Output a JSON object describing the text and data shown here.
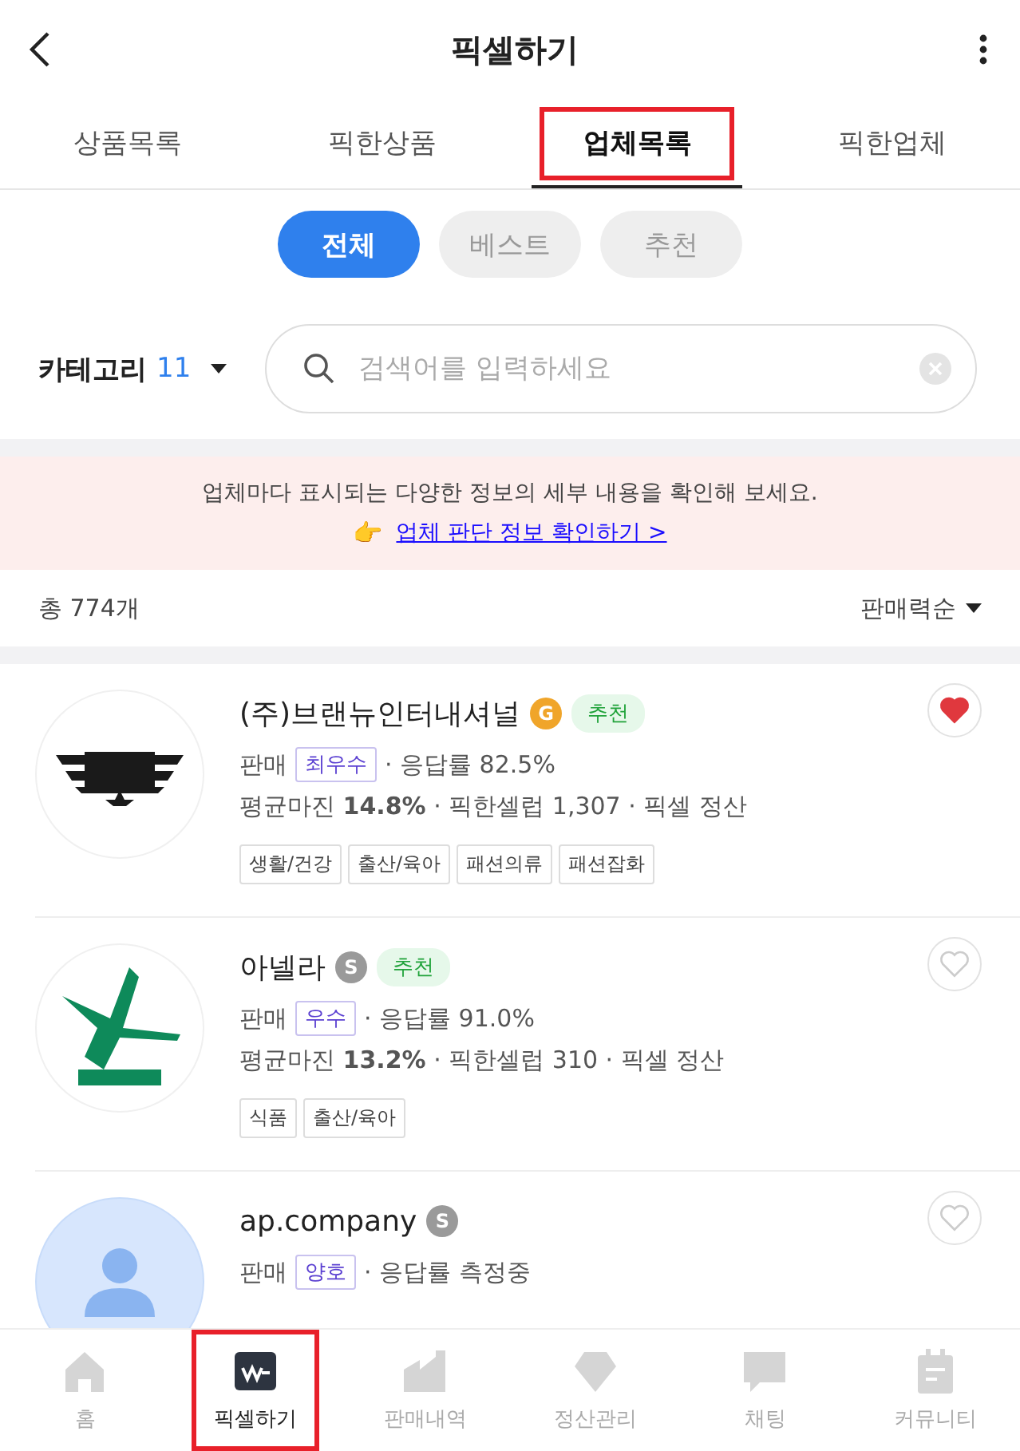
{
  "header": {
    "title": "픽셀하기"
  },
  "tabs": [
    {
      "label": "상품목록",
      "selected": false,
      "highlighted": false
    },
    {
      "label": "픽한상품",
      "selected": false,
      "highlighted": false
    },
    {
      "label": "업체목록",
      "selected": true,
      "highlighted": true
    },
    {
      "label": "픽한업체",
      "selected": false,
      "highlighted": false
    }
  ],
  "filters": [
    {
      "label": "전체",
      "selected": true
    },
    {
      "label": "베스트",
      "selected": false
    },
    {
      "label": "추천",
      "selected": false
    }
  ],
  "category": {
    "label": "카테고리",
    "count": "11"
  },
  "search": {
    "placeholder": "검색어를 입력하세요"
  },
  "notice": {
    "text": "업체마다 표시되는 다양한 정보의 세부 내용을 확인해 보세요.",
    "emoji": "👉",
    "link": "업체 판단 정보 확인하기 >"
  },
  "summary": {
    "total": "총 774개",
    "sort": "판매력순"
  },
  "vendors": [
    {
      "logo": {
        "kind": "wings"
      },
      "name": "(주)브랜뉴인터내셔널",
      "grade": {
        "label": "G",
        "kind": "gold"
      },
      "recommended": "추천",
      "liked": true,
      "sales_label": "판매",
      "sales_grade": "최우수",
      "response": "· 응답률 82.5%",
      "stats": "평균마진 **14.8%** · 픽한셀럽 1,307 · 픽셀 정산",
      "tags": [
        "생활/건강",
        "출산/육아",
        "패션의류",
        "패션잡화"
      ]
    },
    {
      "logo": {
        "kind": "bird"
      },
      "name": "아넬라",
      "grade": {
        "label": "S",
        "kind": "silver"
      },
      "recommended": "추천",
      "liked": false,
      "sales_label": "판매",
      "sales_grade": "우수",
      "response": "· 응답률 91.0%",
      "stats": "평균마진 **13.2%** · 픽한셀럽 310 · 픽셀 정산",
      "tags": [
        "식품",
        "출산/육아"
      ]
    },
    {
      "logo": {
        "kind": "avatar"
      },
      "name": "ap.company",
      "grade": {
        "label": "S",
        "kind": "silver"
      },
      "liked": false,
      "sales_label": "판매",
      "sales_grade": "양호",
      "response": "· 응답률 측정중"
    }
  ],
  "nav": [
    {
      "kind": "home",
      "label": "홈",
      "selected": false,
      "highlighted": false
    },
    {
      "kind": "pick",
      "label": "픽셀하기",
      "selected": true,
      "highlighted": true
    },
    {
      "kind": "factory",
      "label": "판매내역",
      "selected": false,
      "highlighted": false
    },
    {
      "kind": "gem",
      "label": "정산관리",
      "selected": false,
      "highlighted": false
    },
    {
      "kind": "chat",
      "label": "채팅",
      "selected": false,
      "highlighted": false
    },
    {
      "kind": "calendar",
      "label": "커뮤니티",
      "selected": false,
      "highlighted": false
    }
  ]
}
